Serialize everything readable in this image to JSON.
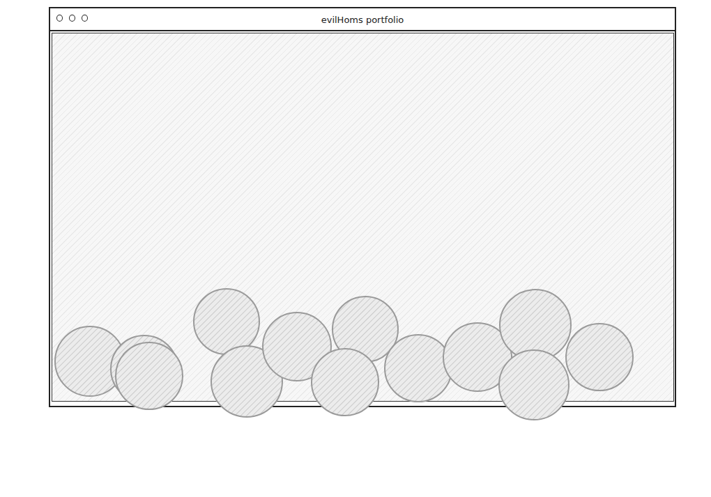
{
  "window": {
    "title": "evilHoms portfolio"
  }
}
